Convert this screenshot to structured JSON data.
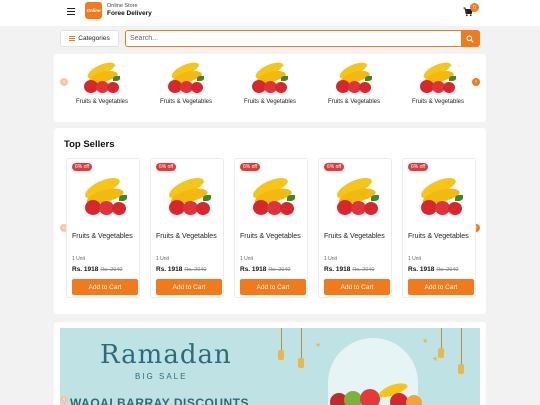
{
  "header": {
    "logo_text": "Online",
    "store_subtitle": "Online Store",
    "store_title": "Foree Delivery",
    "cart_count": "0"
  },
  "toolbar": {
    "categories_label": "Categories",
    "search_placeholder": "Search..."
  },
  "categories": {
    "items": [
      {
        "label": "Fruits & Vegetables"
      },
      {
        "label": "Fruits & Vegetables"
      },
      {
        "label": "Fruits & Vegetables"
      },
      {
        "label": "Fruits & Vegetables"
      },
      {
        "label": "Fruits & Vegetables"
      }
    ]
  },
  "top_sellers": {
    "title": "Top Sellers",
    "products": [
      {
        "badge": "6% off",
        "name": "Fruits & Vegetables",
        "unit": "1 Unit",
        "price": "Rs. 1918",
        "old_price": "Rs. 2040",
        "cta": "Add to Cart"
      },
      {
        "badge": "6% off",
        "name": "Fruits & Vegetables",
        "unit": "1 Unit",
        "price": "Rs. 1918",
        "old_price": "Rs. 2040",
        "cta": "Add to Cart"
      },
      {
        "badge": "6% off",
        "name": "Fruits & Vegetables",
        "unit": "1 Unit",
        "price": "Rs. 1918",
        "old_price": "Rs. 2040",
        "cta": "Add to Cart"
      },
      {
        "badge": "6% off",
        "name": "Fruits & Vegetables",
        "unit": "1 Unit",
        "price": "Rs. 1918",
        "old_price": "Rs. 2040",
        "cta": "Add to Cart"
      },
      {
        "badge": "6% off",
        "name": "Fruits & Vegetables",
        "unit": "1 Unit",
        "price": "Rs. 1918",
        "old_price": "Rs. 2040",
        "cta": "Add to Cart"
      }
    ]
  },
  "banner": {
    "title": "Ramadan",
    "subtitle": "BIG SALE",
    "discount_text": "WAQAI BARRAY DISCOUNTS"
  },
  "icons": {
    "menu": "menu-icon",
    "cart": "cart-icon",
    "search": "search-icon",
    "prev": "chevron-left-icon",
    "next": "chevron-right-icon"
  },
  "colors": {
    "accent": "#f07a1c",
    "badge": "#e23b3b",
    "banner_bg": "#bfe3e5",
    "banner_text": "#2d6b78"
  }
}
